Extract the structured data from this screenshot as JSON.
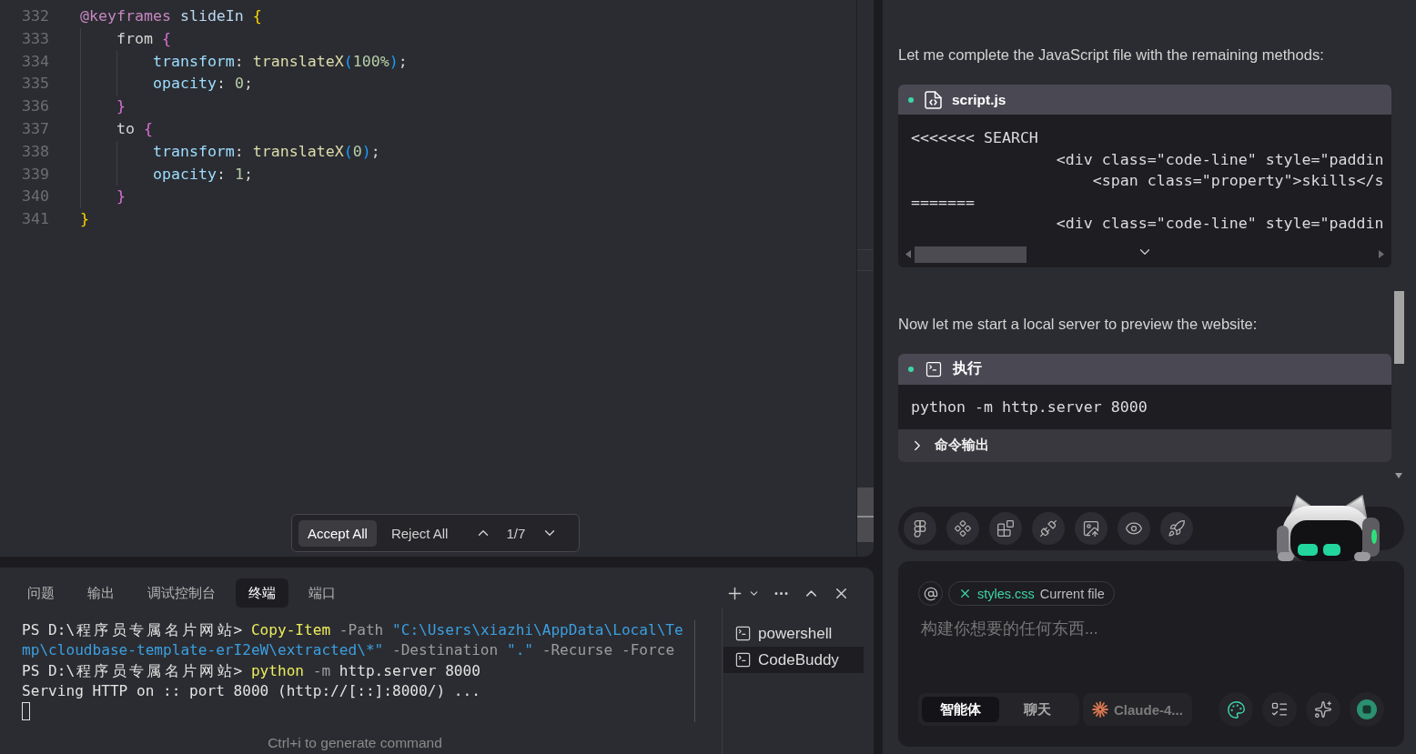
{
  "editor": {
    "lines": [
      {
        "number": "332",
        "text": "@keyframes slideIn {"
      },
      {
        "number": "333",
        "text": "    from {"
      },
      {
        "number": "334",
        "text": "        transform: translateX(100%);"
      },
      {
        "number": "335",
        "text": "        opacity: 0;"
      },
      {
        "number": "336",
        "text": "    }"
      },
      {
        "number": "337",
        "text": "    to {"
      },
      {
        "number": "338",
        "text": "        transform: translateX(0);"
      },
      {
        "number": "339",
        "text": "        opacity: 1;"
      },
      {
        "number": "340",
        "text": "    }"
      },
      {
        "number": "341",
        "text": "}"
      }
    ],
    "diff_review": {
      "accept_label": "Accept All",
      "reject_label": "Reject All",
      "position": "1/7"
    }
  },
  "terminal": {
    "tabs": [
      {
        "label": "问题",
        "selected": false
      },
      {
        "label": "输出",
        "selected": false
      },
      {
        "label": "调试控制台",
        "selected": false
      },
      {
        "label": "终端",
        "selected": true
      },
      {
        "label": "端口",
        "selected": false
      }
    ],
    "lines": [
      {
        "segments": [
          {
            "kind": "prompt",
            "text": "PS D:\\程序员专属名片网站>"
          },
          {
            "kind": "command",
            "text": "Copy-Item"
          },
          {
            "kind": "parameter",
            "text": "-Path"
          },
          {
            "kind": "string",
            "text": "\"C:\\Users\\xiazhi\\AppData\\Local\\Te"
          }
        ]
      },
      {
        "segments": [
          {
            "kind": "string",
            "text": "mp\\cloudbase-template-erI2eW\\extracted\\*\""
          },
          {
            "kind": "parameter",
            "text": "-Destination"
          },
          {
            "kind": "string",
            "text": "\".\""
          },
          {
            "kind": "parameter",
            "text": "-Recurse -Force"
          }
        ]
      },
      {
        "segments": [
          {
            "kind": "prompt",
            "text": "PS D:\\程序员专属名片网站>"
          },
          {
            "kind": "command",
            "text": "python"
          },
          {
            "kind": "parameter",
            "text": "-m"
          },
          {
            "kind": "plain",
            "text": "http.server 8000"
          }
        ]
      },
      {
        "segments": [
          {
            "kind": "plain",
            "text": "Serving HTTP on :: port 8000 (http://[::]:8000/) ..."
          }
        ]
      }
    ],
    "hint": "Ctrl+i to generate command",
    "sessions": [
      {
        "name": "powershell",
        "selected": false
      },
      {
        "name": "CodeBuddy",
        "selected": true
      }
    ]
  },
  "chat": {
    "messages": [
      {
        "kind": "text",
        "text": "Let me complete the JavaScript file with the remaining methods:"
      },
      {
        "kind": "code",
        "title": "script.js",
        "lines": [
          "<<<<<<< SEARCH",
          "                <div class=\"code-line\" style=\"paddin",
          "                    <span class=\"property\">skills</s",
          "=======",
          "                <div class=\"code-line\" style=\"paddin"
        ]
      },
      {
        "kind": "text",
        "text": "Now let me start a local server to preview the website:"
      },
      {
        "kind": "command",
        "title": "执行",
        "command": "python -m http.server 8000",
        "output_label": "命令输出",
        "output_expanded": false
      }
    ],
    "composer": {
      "context_chip": {
        "file": "styles.css",
        "note": "Current file"
      },
      "placeholder": "构建你想要的任何东西...",
      "modes": [
        {
          "label": "智能体",
          "selected": true
        },
        {
          "label": "聊天",
          "selected": false
        }
      ],
      "model": "Claude-4..."
    }
  }
}
